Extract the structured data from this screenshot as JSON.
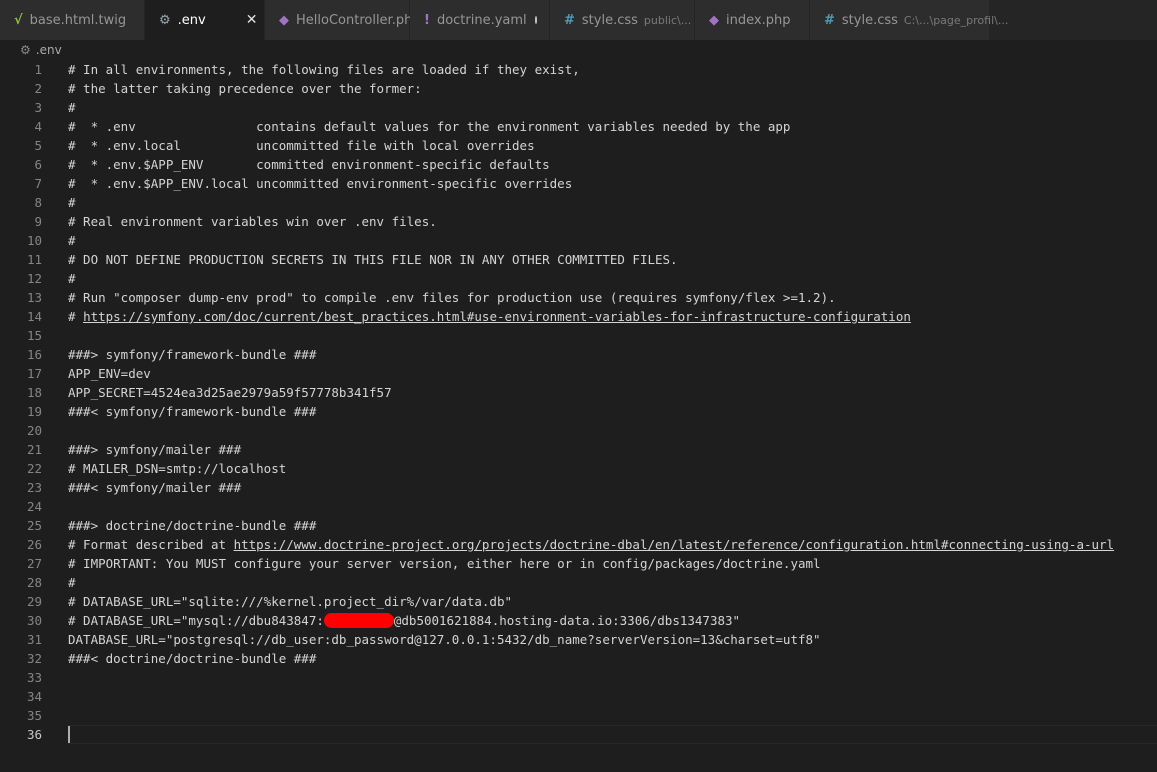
{
  "tabs": [
    {
      "label": "base.html.twig",
      "icon": "twig-icon",
      "icon_glyph": "√",
      "icon_color": "#8dc149",
      "hint": "",
      "active": false,
      "dirty": false
    },
    {
      "label": ".env",
      "icon": "gear-icon",
      "icon_glyph": "⚙",
      "icon_color": "#9da5b4",
      "hint": "",
      "active": true,
      "dirty": false,
      "close": "✕"
    },
    {
      "label": "HelloController.php",
      "icon": "php-elephant-icon",
      "icon_glyph": "◆",
      "icon_color": "#a074c4",
      "hint": "",
      "active": false,
      "dirty": false
    },
    {
      "label": "doctrine.yaml",
      "icon": "yaml-exclamation-icon",
      "icon_glyph": "!",
      "icon_color": "#a074c4",
      "hint": "",
      "active": false,
      "dirty": true
    },
    {
      "label": "style.css",
      "icon": "css-hash-icon",
      "icon_glyph": "#",
      "icon_color": "#519aba",
      "hint": "public\\...",
      "active": false,
      "dirty": false
    },
    {
      "label": "index.php",
      "icon": "php-elephant-icon",
      "icon_glyph": "◆",
      "icon_color": "#a074c4",
      "hint": "",
      "active": false,
      "dirty": false
    },
    {
      "label": "style.css",
      "icon": "css-hash-icon",
      "icon_glyph": "#",
      "icon_color": "#519aba",
      "hint": "C:\\...\\page_profil\\...",
      "active": false,
      "dirty": false
    }
  ],
  "breadcrumb": {
    "icon": "gear-icon",
    "icon_glyph": "⚙",
    "label": ".env"
  },
  "editor": {
    "current_line": 36,
    "lines": [
      {
        "n": "1",
        "text": "# In all environments, the following files are loaded if they exist,"
      },
      {
        "n": "2",
        "text": "# the latter taking precedence over the former:"
      },
      {
        "n": "3",
        "text": "#"
      },
      {
        "n": "4",
        "text": "#  * .env                contains default values for the environment variables needed by the app"
      },
      {
        "n": "5",
        "text": "#  * .env.local          uncommitted file with local overrides"
      },
      {
        "n": "6",
        "text": "#  * .env.$APP_ENV       committed environment-specific defaults"
      },
      {
        "n": "7",
        "text": "#  * .env.$APP_ENV.local uncommitted environment-specific overrides"
      },
      {
        "n": "8",
        "text": "#"
      },
      {
        "n": "9",
        "text": "# Real environment variables win over .env files."
      },
      {
        "n": "10",
        "text": "#"
      },
      {
        "n": "11",
        "text": "# DO NOT DEFINE PRODUCTION SECRETS IN THIS FILE NOR IN ANY OTHER COMMITTED FILES."
      },
      {
        "n": "12",
        "text": "#"
      },
      {
        "n": "13",
        "text": "# Run \"composer dump-env prod\" to compile .env files for production use (requires symfony/flex >=1.2)."
      },
      {
        "n": "14",
        "pre": "# ",
        "link": "https://symfony.com/doc/current/best_practices.html#use-environment-variables-for-infrastructure-configuration",
        "post": ""
      },
      {
        "n": "15",
        "text": ""
      },
      {
        "n": "16",
        "text": "###> symfony/framework-bundle ###"
      },
      {
        "n": "17",
        "text": "APP_ENV=dev"
      },
      {
        "n": "18",
        "text": "APP_SECRET=4524ea3d25ae2979a59f57778b341f57"
      },
      {
        "n": "19",
        "text": "###< symfony/framework-bundle ###"
      },
      {
        "n": "20",
        "text": ""
      },
      {
        "n": "21",
        "text": "###> symfony/mailer ###"
      },
      {
        "n": "22",
        "text": "# MAILER_DSN=smtp://localhost"
      },
      {
        "n": "23",
        "text": "###< symfony/mailer ###"
      },
      {
        "n": "24",
        "text": ""
      },
      {
        "n": "25",
        "text": "###> doctrine/doctrine-bundle ###"
      },
      {
        "n": "26",
        "pre": "# Format described at ",
        "link": "https://www.doctrine-project.org/projects/doctrine-dbal/en/latest/reference/configuration.html#connecting-using-a-url",
        "post": ""
      },
      {
        "n": "27",
        "text": "# IMPORTANT: You MUST configure your server version, either here or in config/packages/doctrine.yaml"
      },
      {
        "n": "28",
        "text": "#"
      },
      {
        "n": "29",
        "text": "# DATABASE_URL=\"sqlite:///%kernel.project_dir%/var/data.db\""
      },
      {
        "n": "30",
        "pre": "# DATABASE_URL=\"mysql://dbu843847:",
        "redacted": true,
        "post": "@db5001621884.hosting-data.io:3306/dbs1347383\""
      },
      {
        "n": "31",
        "text": "DATABASE_URL=\"postgresql://db_user:db_password@127.0.0.1:5432/db_name?serverVersion=13&charset=utf8\""
      },
      {
        "n": "32",
        "text": "###< doctrine/doctrine-bundle ###"
      },
      {
        "n": "33",
        "text": ""
      },
      {
        "n": "34",
        "text": ""
      },
      {
        "n": "35",
        "text": ""
      },
      {
        "n": "36",
        "text": "",
        "cursor": true
      }
    ]
  }
}
